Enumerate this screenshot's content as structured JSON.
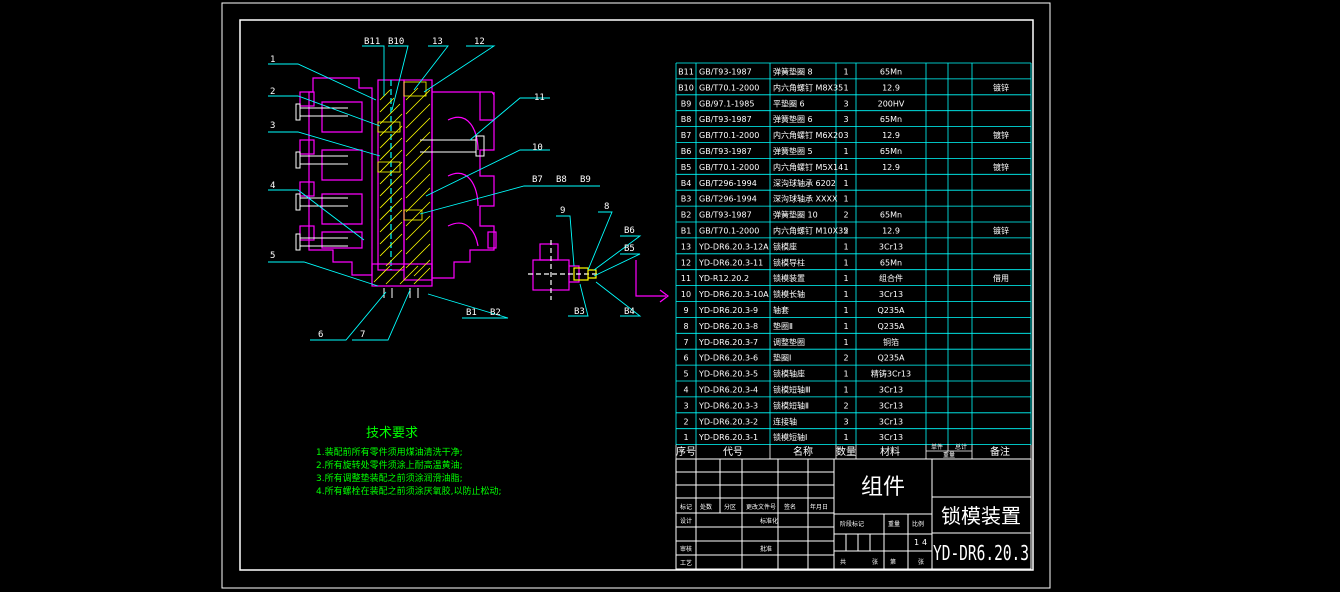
{
  "colors": {
    "background": "#000000",
    "frame": "#ffffff",
    "part": "#ff00ff",
    "leader": "#00ffff",
    "text": "#ffffff",
    "note": "#00ff00",
    "hatch": "#ffff00"
  },
  "callouts": {
    "top": [
      "B11",
      "B10",
      "13",
      "12"
    ],
    "left": [
      "1",
      "2",
      "3",
      "4",
      "5"
    ],
    "bottom": [
      "6",
      "7",
      "B1",
      "B2"
    ],
    "right": [
      "11",
      "10",
      "B7",
      "B8",
      "B9"
    ],
    "detail": [
      "9",
      "8",
      "B6",
      "B5",
      "B3",
      "B4"
    ]
  },
  "notes": {
    "title": "技术要求",
    "lines": [
      "1.装配前所有零件须用煤油清洗干净;",
      "2.所有旋转处零件须涂上耐高温黄油;",
      "3.所有调整垫装配之前须涂润滑油脂;",
      "4.所有螺栓在装配之前须涂厌氧胶,以防止松动;"
    ]
  },
  "parts_table": {
    "header": {
      "no": "序号",
      "code": "代号",
      "name": "名称",
      "qty": "数量",
      "material": "材料",
      "single": "单件",
      "total": "总计",
      "weight": "重量",
      "remark": "备注"
    },
    "rows": [
      {
        "no": "B11",
        "code": "GB/T93-1987",
        "name": "弹簧垫圈 8",
        "qty": "1",
        "material": "65Mn",
        "remark": ""
      },
      {
        "no": "B10",
        "code": "GB/T70.1-2000",
        "name": "内六角螺钉 M8X35",
        "qty": "1",
        "material": "12.9",
        "remark": "镀锌"
      },
      {
        "no": "B9",
        "code": "GB/97.1-1985",
        "name": "平垫圈 6",
        "qty": "3",
        "material": "200HV",
        "remark": ""
      },
      {
        "no": "B8",
        "code": "GB/T93-1987",
        "name": "弹簧垫圈 6",
        "qty": "3",
        "material": "65Mn",
        "remark": ""
      },
      {
        "no": "B7",
        "code": "GB/T70.1-2000",
        "name": "内六角螺钉 M6X20",
        "qty": "3",
        "material": "12.9",
        "remark": "镀锌"
      },
      {
        "no": "B6",
        "code": "GB/T93-1987",
        "name": "弹簧垫圈 5",
        "qty": "1",
        "material": "65Mn",
        "remark": ""
      },
      {
        "no": "B5",
        "code": "GB/T70.1-2000",
        "name": "内六角螺钉 M5X14",
        "qty": "1",
        "material": "12.9",
        "remark": "镀锌"
      },
      {
        "no": "B4",
        "code": "GB/T296-1994",
        "name": "深沟球轴承 6202",
        "qty": "1",
        "material": "",
        "remark": ""
      },
      {
        "no": "B3",
        "code": "GB/T296-1994",
        "name": "深沟球轴承 XXXX",
        "qty": "1",
        "material": "",
        "remark": ""
      },
      {
        "no": "B2",
        "code": "GB/T93-1987",
        "name": "弹簧垫圈 10",
        "qty": "2",
        "material": "65Mn",
        "remark": ""
      },
      {
        "no": "B1",
        "code": "GB/T70.1-2000",
        "name": "内六角螺钉 M10X35",
        "qty": "2",
        "material": "12.9",
        "remark": "镀锌"
      },
      {
        "no": "13",
        "code": "YD-DR6.20.3-12A",
        "name": "锁模座",
        "qty": "1",
        "material": "3Cr13",
        "remark": ""
      },
      {
        "no": "12",
        "code": "YD-DR6.20.3-11",
        "name": "锁模导柱",
        "qty": "1",
        "material": "65Mn",
        "remark": ""
      },
      {
        "no": "11",
        "code": "YD-R12.20.2",
        "name": "锁模装置",
        "qty": "1",
        "material": "组合件",
        "remark": "借用"
      },
      {
        "no": "10",
        "code": "YD-DR6.20.3-10A",
        "name": "锁模长轴",
        "qty": "1",
        "material": "3Cr13",
        "remark": ""
      },
      {
        "no": "9",
        "code": "YD-DR6.20.3-9",
        "name": "轴套",
        "qty": "1",
        "material": "Q235A",
        "remark": ""
      },
      {
        "no": "8",
        "code": "YD-DR6.20.3-8",
        "name": "垫圈Ⅱ",
        "qty": "1",
        "material": "Q235A",
        "remark": ""
      },
      {
        "no": "7",
        "code": "YD-DR6.20.3-7",
        "name": "调整垫圈",
        "qty": "1",
        "material": "铜箔",
        "remark": ""
      },
      {
        "no": "6",
        "code": "YD-DR6.20.3-6",
        "name": "垫圈Ⅰ",
        "qty": "2",
        "material": "Q235A",
        "remark": ""
      },
      {
        "no": "5",
        "code": "YD-DR6.20.3-5",
        "name": "锁模轴座",
        "qty": "1",
        "material": "精铸3Cr13",
        "remark": ""
      },
      {
        "no": "4",
        "code": "YD-DR6.20.3-4",
        "name": "锁模短轴Ⅲ",
        "qty": "1",
        "material": "3Cr13",
        "remark": ""
      },
      {
        "no": "3",
        "code": "YD-DR6.20.3-3",
        "name": "锁模短轴Ⅱ",
        "qty": "2",
        "material": "3Cr13",
        "remark": ""
      },
      {
        "no": "2",
        "code": "YD-DR6.20.3-2",
        "name": "连接轴",
        "qty": "3",
        "material": "3Cr13",
        "remark": ""
      },
      {
        "no": "1",
        "code": "YD-DR6.20.3-1",
        "name": "锁模短轴Ⅰ",
        "qty": "1",
        "material": "3Cr13",
        "remark": ""
      }
    ]
  },
  "title_block": {
    "assembly": "组件",
    "name": "锁模装置",
    "drawing_no": "YD-DR6.20.3",
    "sheet_count": "1",
    "sheet_no": "4",
    "labels": {
      "mark": "标记",
      "count": "处数",
      "zone": "分区",
      "change_doc": "更改文件号",
      "signature": "签名",
      "date": "年月日",
      "design": "设计",
      "standardize": "标准化",
      "check": "审核",
      "process": "工艺",
      "approve": "批准",
      "stage_mark": "阶段标记",
      "weight": "重量",
      "scale": "比例",
      "total_sheets": "共",
      "sheet": "张",
      "page": "第"
    }
  }
}
